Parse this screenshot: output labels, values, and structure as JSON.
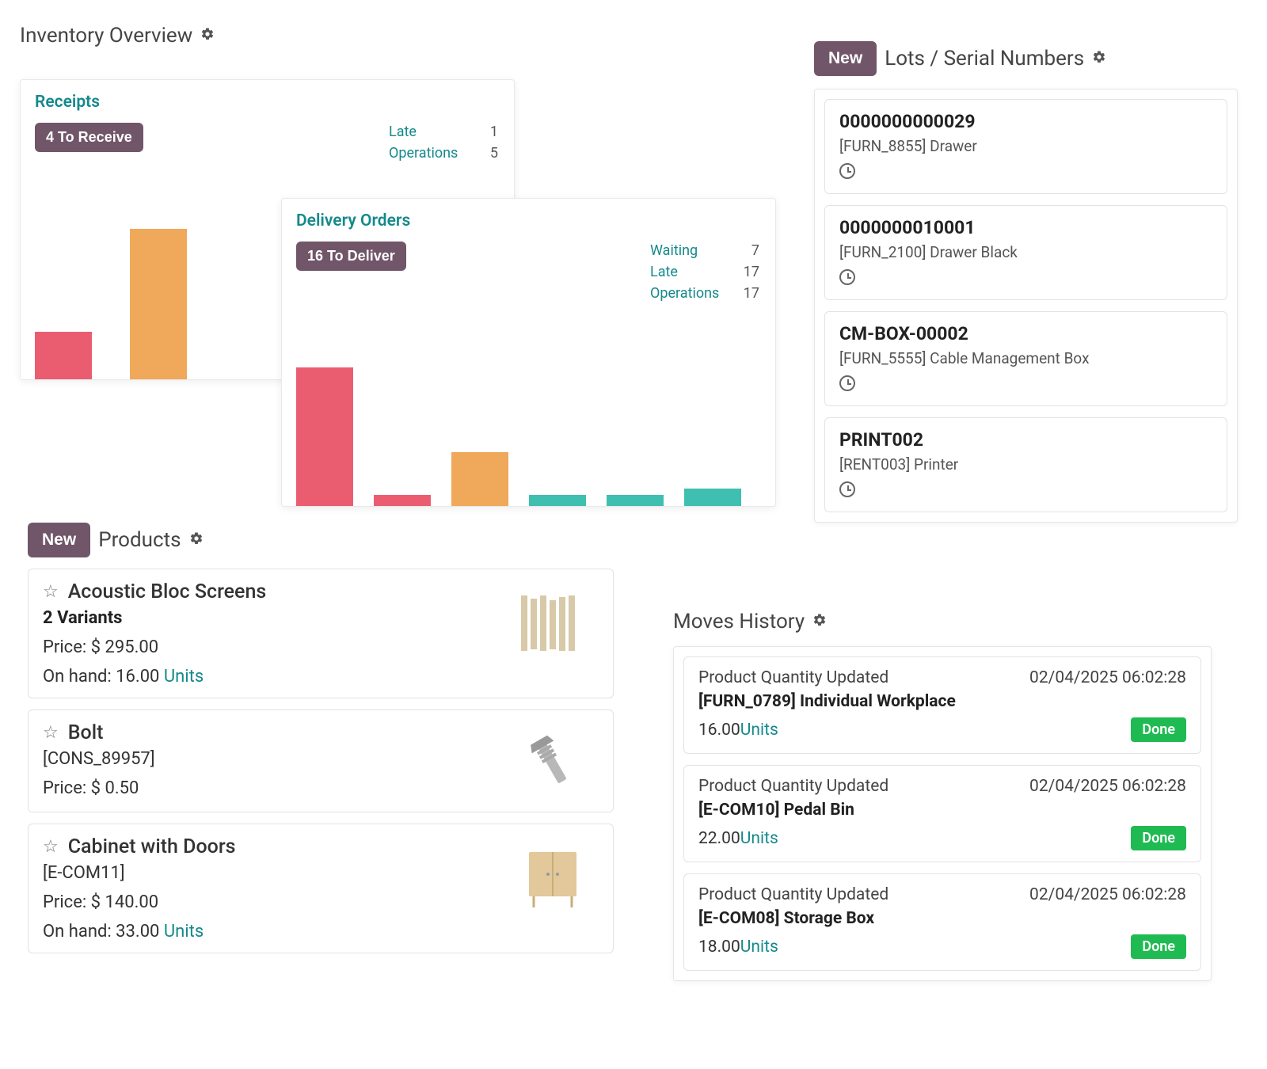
{
  "inventory": {
    "title": "Inventory Overview",
    "receipts": {
      "title": "Receipts",
      "button": "4 To Receive",
      "stats": [
        {
          "label": "Late",
          "value": "1"
        },
        {
          "label": "Operations",
          "value": "5"
        }
      ]
    },
    "delivery": {
      "title": "Delivery Orders",
      "button": "16 To Deliver",
      "stats": [
        {
          "label": "Waiting",
          "value": "7"
        },
        {
          "label": "Late",
          "value": "17"
        },
        {
          "label": "Operations",
          "value": "17"
        }
      ]
    }
  },
  "chart_data": [
    {
      "type": "bar",
      "title": "Receipts",
      "values": [
        60,
        190
      ],
      "colors": [
        "#ea5d71",
        "#f0a85a"
      ]
    },
    {
      "type": "bar",
      "title": "Delivery Orders",
      "values": [
        175,
        14,
        68,
        14,
        14,
        22
      ],
      "colors": [
        "#ea5d71",
        "#ea5d71",
        "#f0a85a",
        "#3fbfb0",
        "#3fbfb0",
        "#3fbfb0"
      ]
    }
  ],
  "products": {
    "title": "Products",
    "new_label": "New",
    "price_label": "Price:",
    "onhand_label": "On hand:",
    "units_label": "Units",
    "items": [
      {
        "name": "Acoustic Bloc Screens",
        "variants": "2 Variants",
        "sku": "",
        "price": "$ 295.00",
        "onhand": "16.00"
      },
      {
        "name": "Bolt",
        "variants": "",
        "sku": "[CONS_89957]",
        "price": "$ 0.50",
        "onhand": ""
      },
      {
        "name": "Cabinet with Doors",
        "variants": "",
        "sku": "[E-COM11]",
        "price": "$ 140.00",
        "onhand": "33.00"
      }
    ]
  },
  "lots": {
    "title": "Lots / Serial Numbers",
    "new_label": "New",
    "items": [
      {
        "number": "0000000000029",
        "desc": "[FURN_8855] Drawer"
      },
      {
        "number": "0000000010001",
        "desc": "[FURN_2100] Drawer Black"
      },
      {
        "number": "CM-BOX-00002",
        "desc": "[FURN_5555] Cable Management Box"
      },
      {
        "number": "PRINT002",
        "desc": "[RENT003] Printer"
      }
    ]
  },
  "moves": {
    "title": "Moves History",
    "done_label": "Done",
    "units_label": "Units",
    "items": [
      {
        "action": "Product Quantity Updated",
        "time": "02/04/2025 06:02:28",
        "product": "[FURN_0789] Individual Workplace",
        "qty": "16.00"
      },
      {
        "action": "Product Quantity Updated",
        "time": "02/04/2025 06:02:28",
        "product": "[E-COM10] Pedal Bin",
        "qty": "22.00"
      },
      {
        "action": "Product Quantity Updated",
        "time": "02/04/2025 06:02:28",
        "product": "[E-COM08] Storage Box",
        "qty": "18.00"
      }
    ]
  }
}
